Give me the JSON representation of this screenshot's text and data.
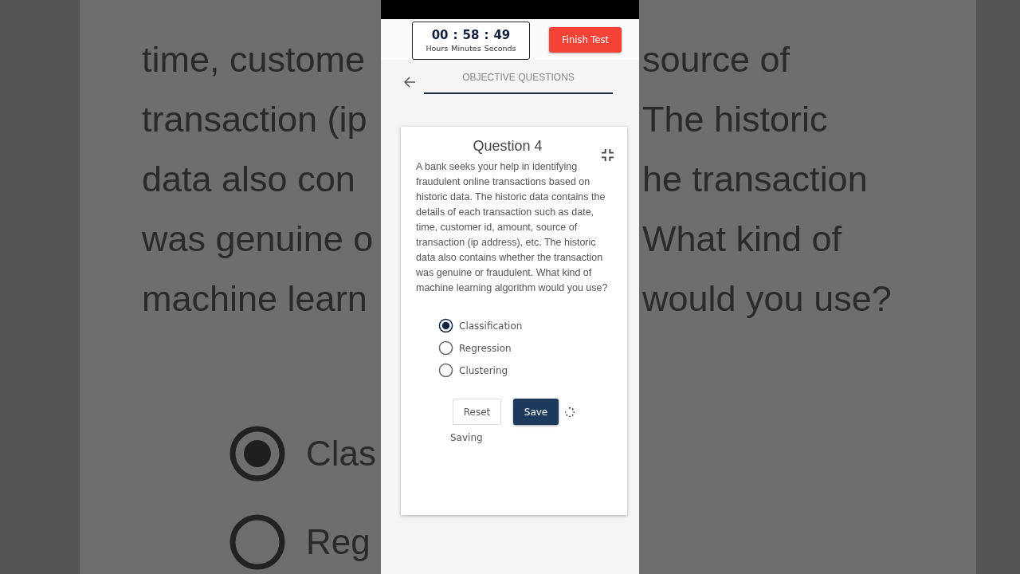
{
  "backdrop": {
    "left_lines": [
      "time, custome",
      "transaction (ip",
      "data also con",
      "was genuine o",
      "machine learn"
    ],
    "right_lines": [
      "source of",
      "The historic",
      "he transaction",
      "What kind of",
      "would you use?"
    ],
    "options": [
      {
        "label": "Clas",
        "selected": true
      },
      {
        "label": "Reg",
        "selected": false
      }
    ]
  },
  "timer": {
    "hours": "00",
    "minutes": "58",
    "seconds": "49",
    "separator": ":",
    "labels": [
      "Hours",
      "Minutes",
      "Seconds"
    ]
  },
  "finish_button": "Finish Test",
  "tab": {
    "label": "OBJECTIVE QUESTIONS",
    "selected": true
  },
  "question": {
    "title": "Question 4",
    "text": "A bank seeks your help in identifying fraudulent online transactions based on historic data. The historic data contains the details of each transaction such as date, time, customer id, amount, source of transaction (ip address), etc. The historic data also contains whether the transaction was genuine or fraudulent. What kind of machine learning algorithm would you use?",
    "options": [
      {
        "label": "Classification",
        "selected": true
      },
      {
        "label": "Regression",
        "selected": false
      },
      {
        "label": "Clustering",
        "selected": false
      }
    ]
  },
  "buttons": {
    "reset": "Reset",
    "save": "Save"
  },
  "status": "Saving"
}
